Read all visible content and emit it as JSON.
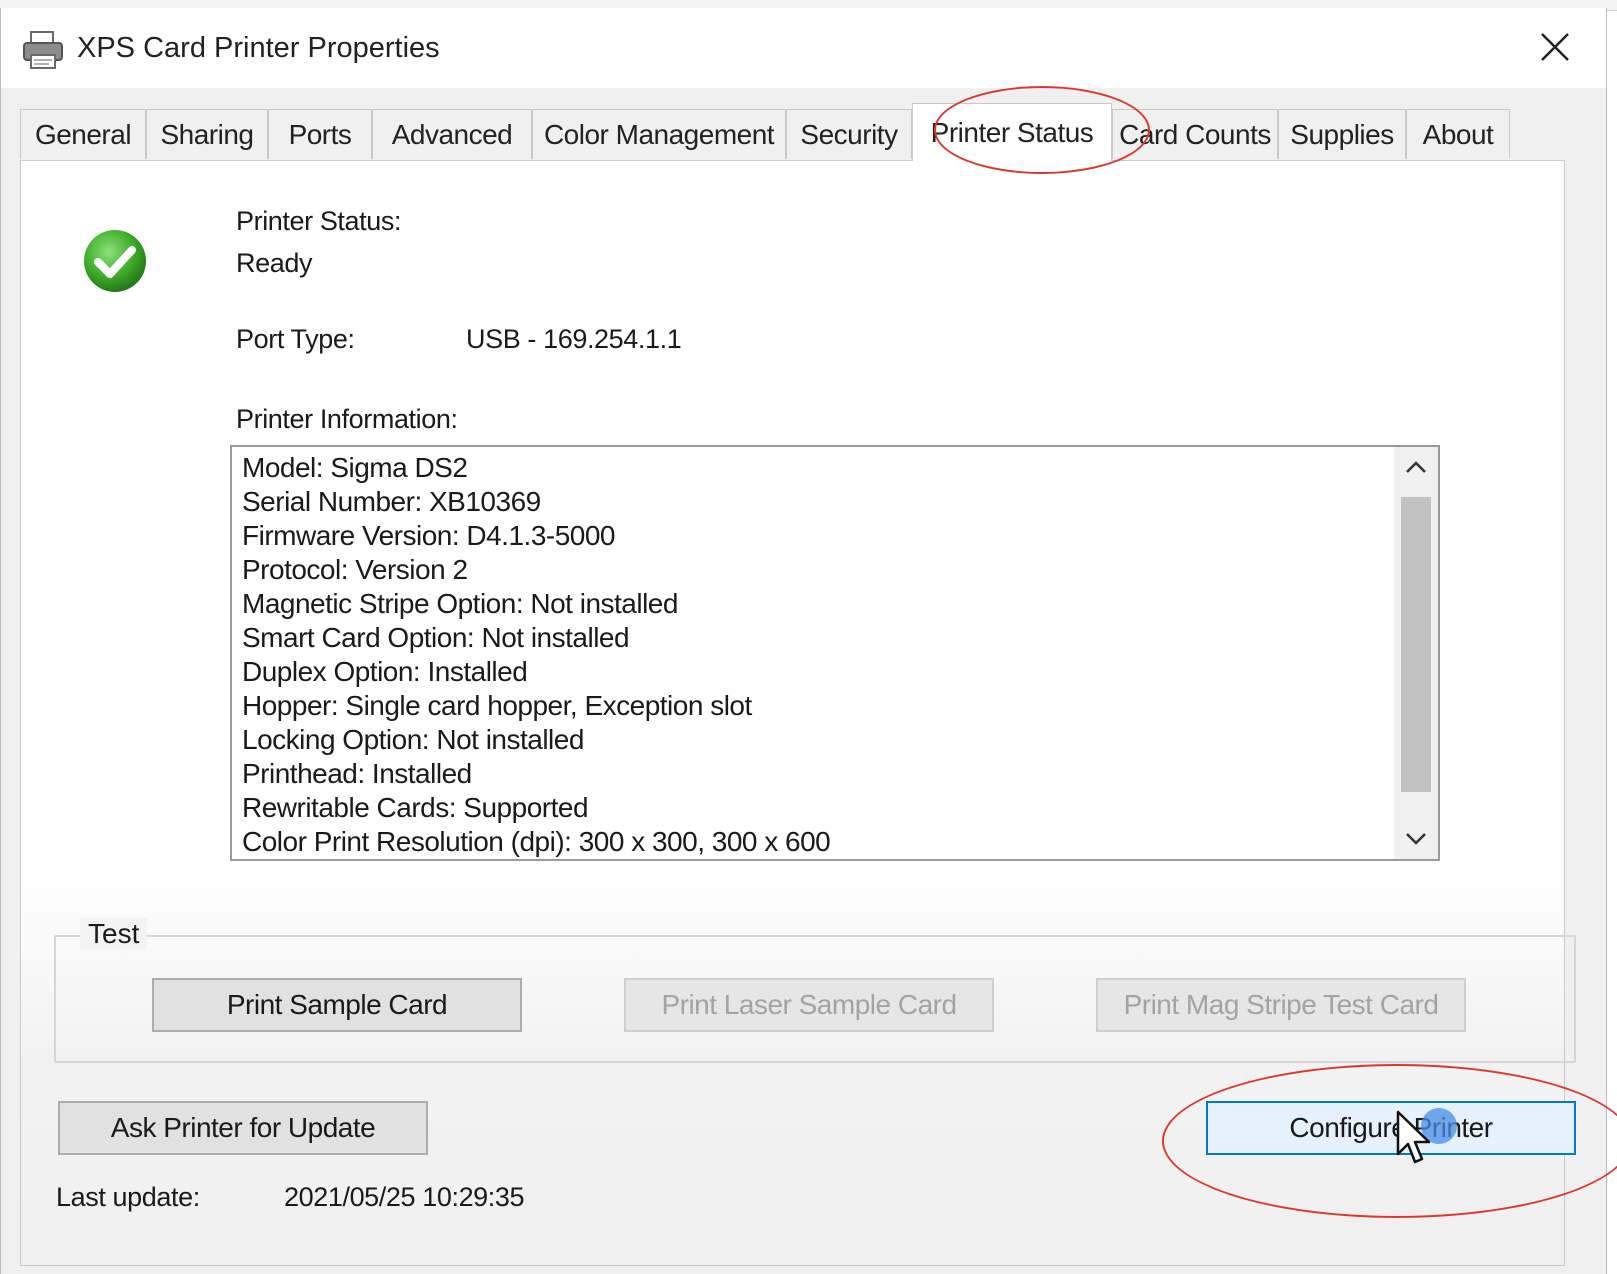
{
  "window": {
    "title": "XPS Card Printer Properties",
    "close_glyph": "✕"
  },
  "tabs": [
    {
      "label": "General"
    },
    {
      "label": "Sharing"
    },
    {
      "label": "Ports"
    },
    {
      "label": "Advanced"
    },
    {
      "label": "Color Management"
    },
    {
      "label": "Security"
    },
    {
      "label": "Printer Status",
      "selected": true
    },
    {
      "label": "Card Counts"
    },
    {
      "label": "Supplies"
    },
    {
      "label": "About"
    }
  ],
  "status": {
    "label": "Printer Status:",
    "value": "Ready",
    "icon": "green-checkmark-icon"
  },
  "port": {
    "label": "Port Type:",
    "value": "USB - 169.254.1.1"
  },
  "info": {
    "label": "Printer Information:",
    "lines": [
      "Model: Sigma DS2",
      "Serial Number: XB10369",
      "Firmware Version: D4.1.3-5000",
      "Protocol: Version 2",
      "Magnetic Stripe Option: Not installed",
      "Smart Card Option: Not installed",
      "Duplex Option: Installed",
      "Hopper: Single card hopper, Exception slot",
      "Locking Option: Not installed",
      "Printhead: Installed",
      "Rewritable Cards: Supported",
      "Color Print Resolution (dpi): 300 x 300, 300 x 600"
    ]
  },
  "test": {
    "label": "Test",
    "print_sample": "Print Sample Card",
    "print_laser": "Print Laser Sample Card",
    "print_mag": "Print Mag Stripe Test Card"
  },
  "actions": {
    "ask_update": "Ask Printer for Update",
    "configure": "Configure Printer"
  },
  "last_update": {
    "label": "Last update:",
    "value": "2021/05/25 10:29:35"
  },
  "colors": {
    "annotation": "#d9392f",
    "focus": "#0078d7",
    "check_green": "#3fae2a"
  }
}
